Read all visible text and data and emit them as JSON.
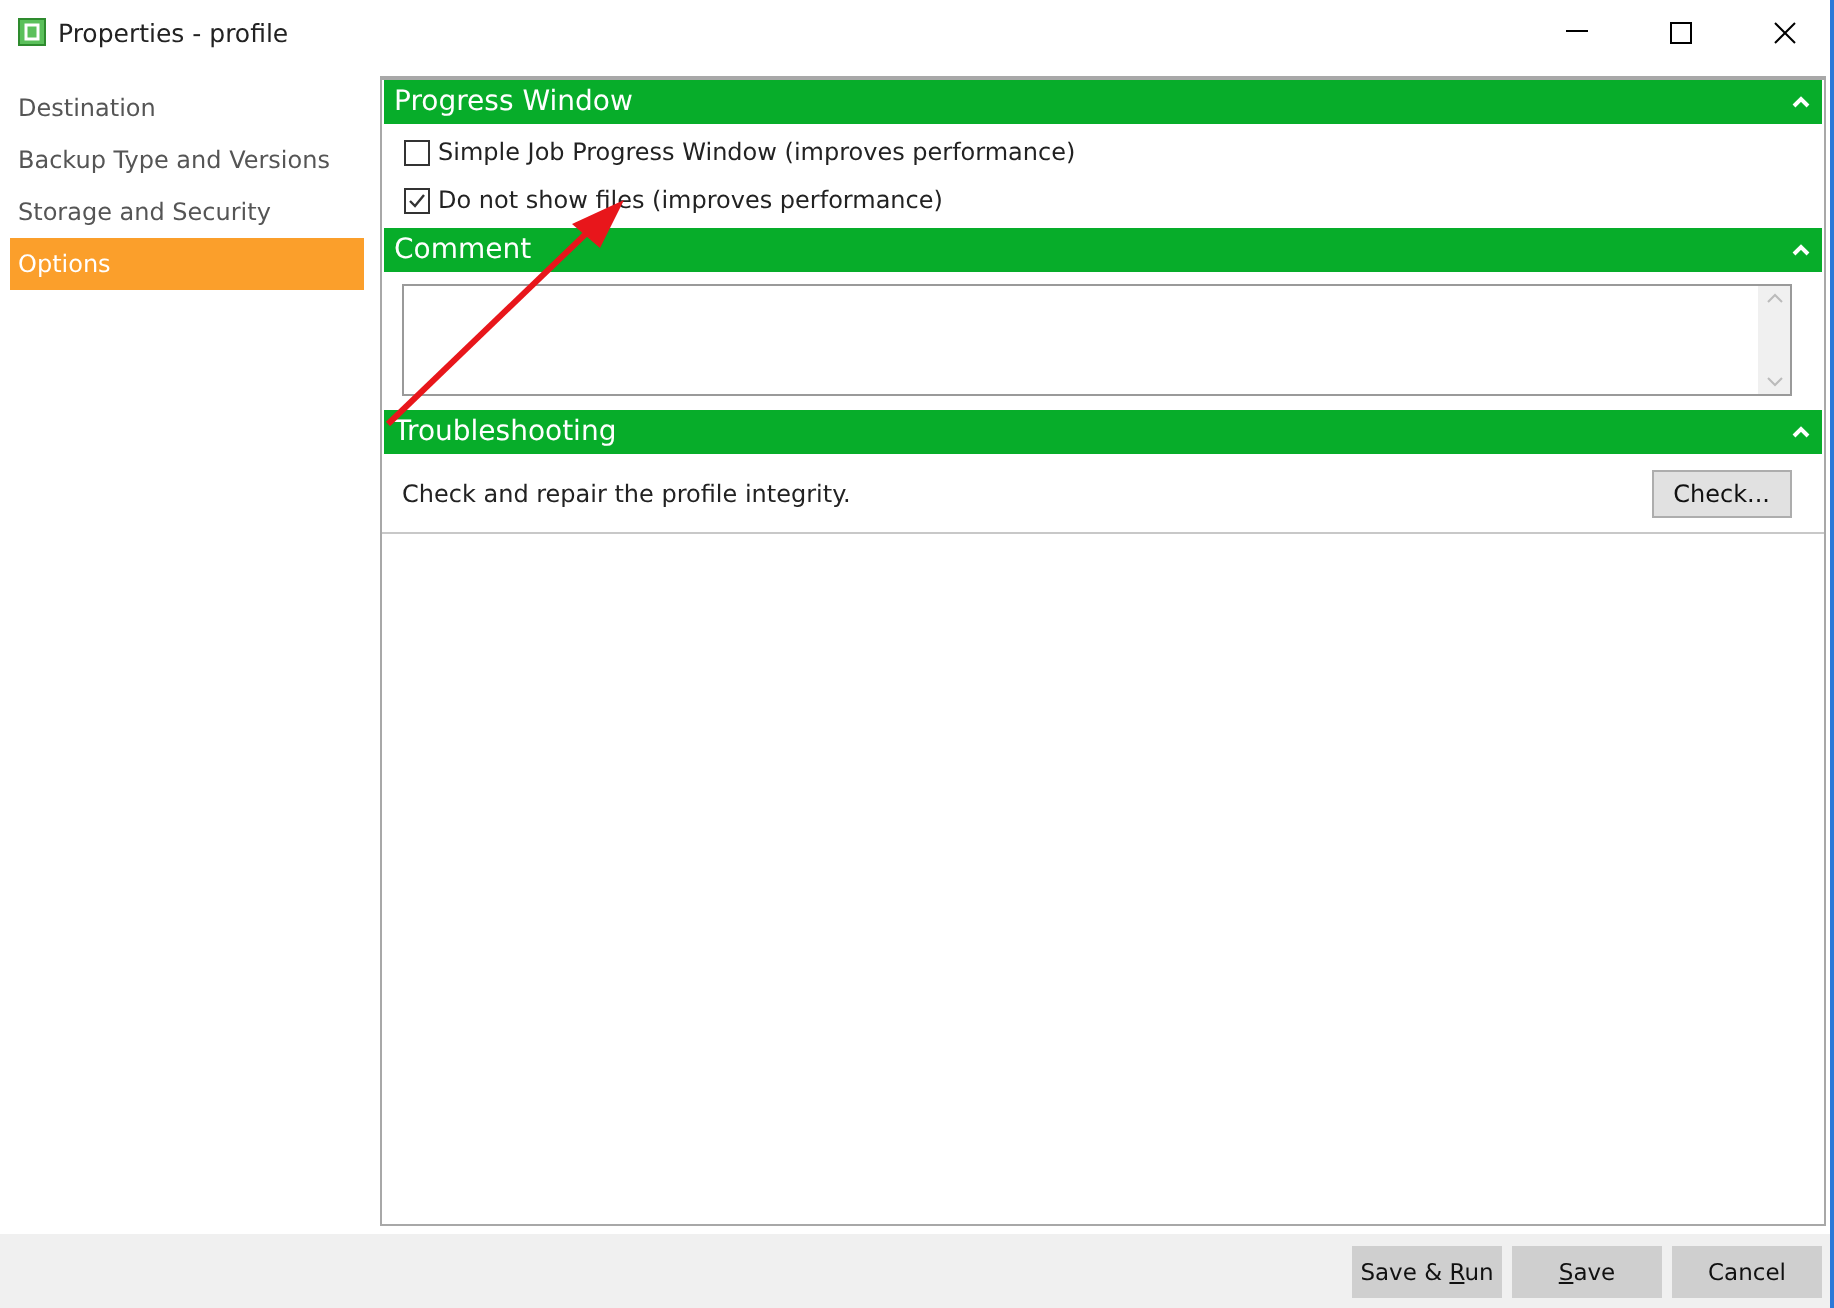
{
  "window": {
    "title": "Properties - profile"
  },
  "sidebar": {
    "items": [
      {
        "label": "Destination",
        "selected": false
      },
      {
        "label": "Backup Type and Versions",
        "selected": false
      },
      {
        "label": "Storage and Security",
        "selected": false
      },
      {
        "label": "Options",
        "selected": true
      }
    ]
  },
  "sections": [
    {
      "kind": "checkboxes",
      "title": "Progress Window",
      "expanded": true,
      "options": [
        {
          "label": "Simple Job Progress Window (improves performance)",
          "checked": false
        },
        {
          "label": "Do not show files (improves performance)",
          "checked": true
        }
      ]
    },
    {
      "kind": "comment",
      "title": "Comment",
      "expanded": true
    },
    {
      "kind": "action",
      "title": "Troubleshooting",
      "expanded": true,
      "text": "Check and repair the profile integrity.",
      "button": "Check..."
    }
  ],
  "buttons": [
    {
      "before": "Save & ",
      "mnemonic": "R",
      "after": "un"
    },
    {
      "mnemonic": "S",
      "after": "ave"
    },
    {
      "before": "Cancel"
    }
  ]
}
